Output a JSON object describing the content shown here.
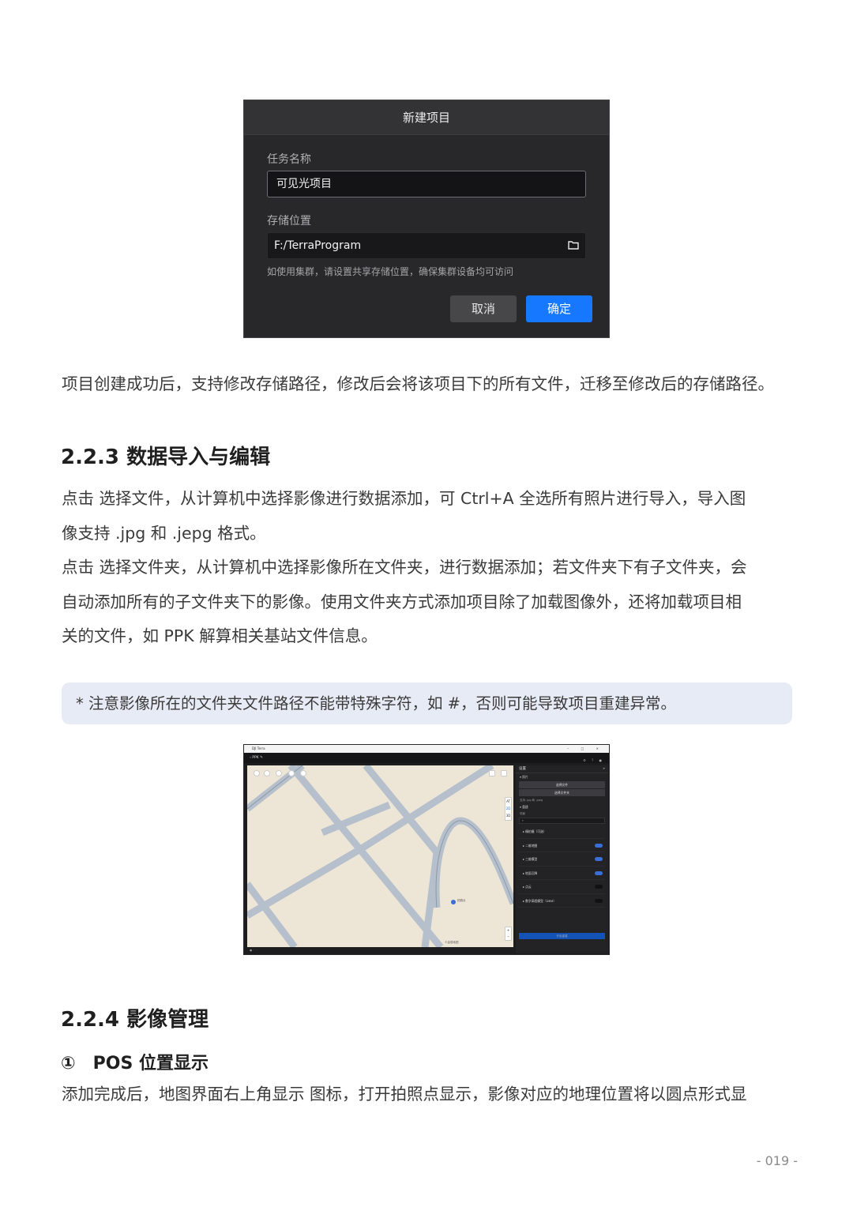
{
  "dialog": {
    "title": "新建项目",
    "task_name_label": "任务名称",
    "task_name_value": "可见光项目",
    "storage_label": "存储位置",
    "storage_value": "F:/TerraProgram",
    "hint": "如使用集群，请设置共享存储位置，确保集群设备均可访问",
    "cancel": "取消",
    "ok": "确定"
  },
  "para1": "项目创建成功后，支持修改存储路径，修改后会将该项目下的所有文件，迁移至修改后的存储路径。",
  "section_223": "2.2.3 数据导入与编辑",
  "para2_lines": [
    "点击 选择文件，从计算机中选择影像进行数据添加，可 Ctrl+A 全选所有照片进行导入，导入图",
    "像支持 .jpg 和 .jepg 格式。",
    "点击 选择文件夹，从计算机中选择影像所在文件夹，进行数据添加；若文件夹下有子文件夹，会",
    "自动添加所有的子文件夹下的影像。使用文件夹方式添加项目除了加载图像外，还将加载项目相",
    "关的文件，如 PPK 解算相关基站文件信息。"
  ],
  "note": "* 注意影像所在的文件夹文件路径不能带特殊字符，如 #，否则可能导致项目重建异常。",
  "app": {
    "window_title": "DJI Terra",
    "window_controls": "– □ ×",
    "project_name": "PPK",
    "panel_title": "设置",
    "photo_section": "照片",
    "select_file": "选择文件",
    "select_folder": "选择文件夹",
    "format_hint": "支持 .jpg 和 .jpeg",
    "recon_section": "重建",
    "scene_label": "场景",
    "rows": [
      "精拍摄（可选）",
      "二维地图",
      "三维模型",
      "地面沉降",
      "点云",
      "数字高程模型（DEM）"
    ],
    "map_badge_top": "AT",
    "map_badge_2d": "2D",
    "map_badge_3d": "3D",
    "map_marker": "拍照点",
    "map_watermark": "©高德地图",
    "zoom_in": "+",
    "zoom_out": "−",
    "start_button": "开始重建"
  },
  "section_224": "2.2.4 影像管理",
  "item1": "①　POS 位置显示",
  "para3": "添加完成后，地图界面右上角显示  图标，打开拍照点显示，影像对应的地理位置将以圆点形式显",
  "page_number": "- 019 -"
}
